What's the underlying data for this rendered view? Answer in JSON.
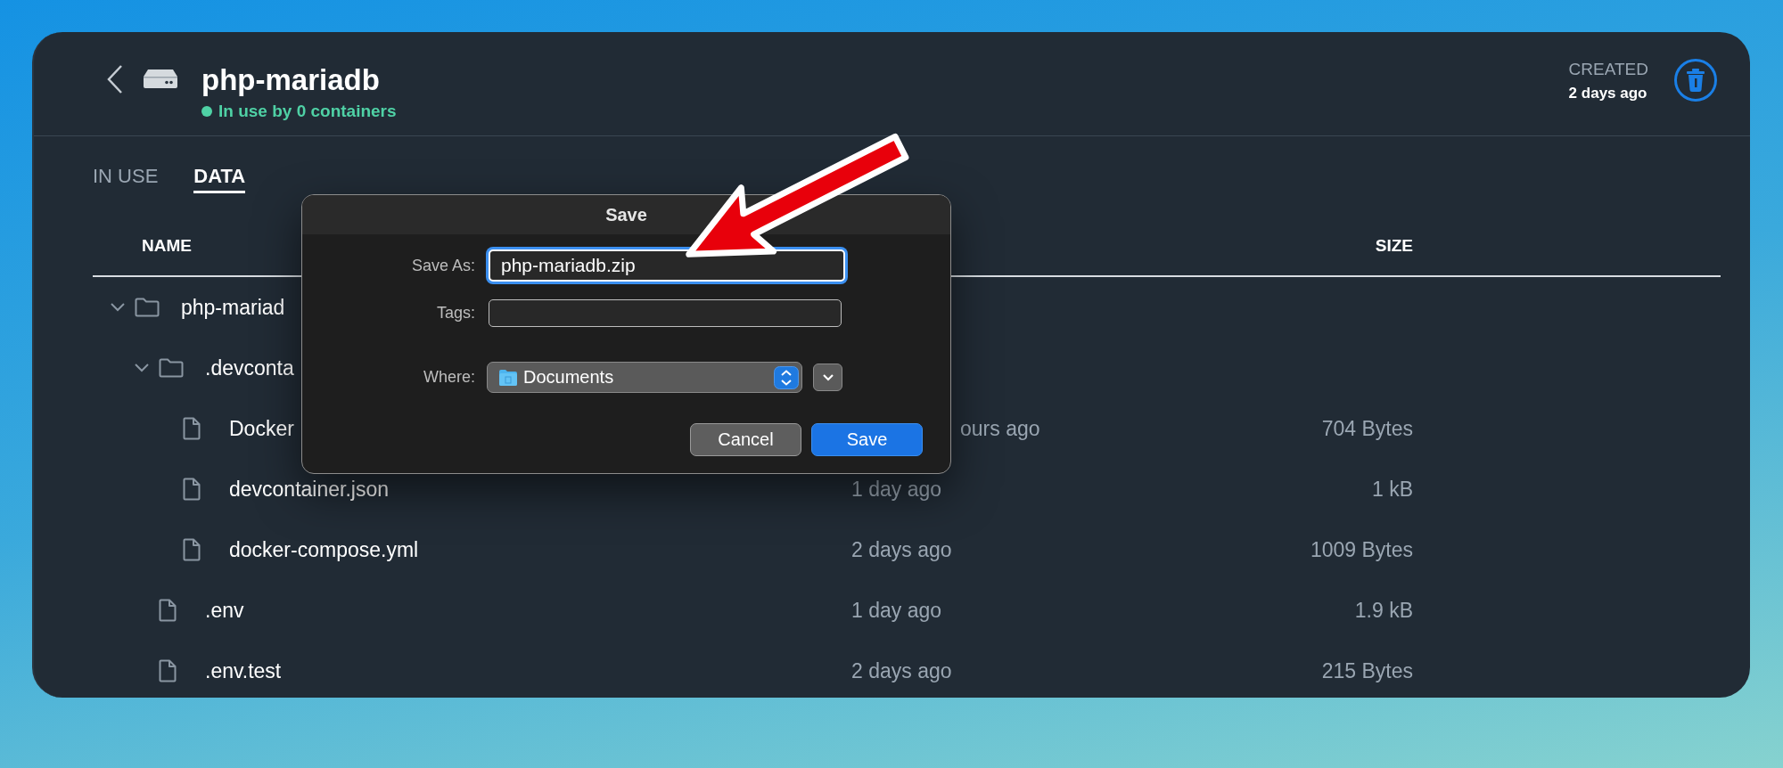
{
  "header": {
    "title": "php-mariadb",
    "status": "In use by 0 containers",
    "created": {
      "label": "CREATED",
      "value": "2 days ago"
    }
  },
  "tabs": [
    {
      "label": "IN USE",
      "selected": false
    },
    {
      "label": "DATA",
      "selected": true
    }
  ],
  "table": {
    "columns": [
      {
        "kind": "name",
        "label": "NAME"
      },
      {
        "kind": "size",
        "label": "SIZE"
      }
    ],
    "rows": [
      {
        "kind": "folder",
        "name": "php-mariad",
        "expanded": true,
        "children": [
          {
            "kind": "folder",
            "name": ".devconta",
            "expanded": true,
            "children": [
              {
                "kind": "file",
                "name": "Docker",
                "modified": "ours ago",
                "modified_cut_start": true,
                "size": "704 Bytes"
              },
              {
                "kind": "file",
                "name": "devcontainer.json",
                "modified": "1 day ago",
                "size": "1 kB"
              },
              {
                "kind": "file",
                "name": "docker-compose.yml",
                "modified": "2 days ago",
                "size": "1009 Bytes"
              }
            ]
          },
          {
            "kind": "file",
            "name": ".env",
            "modified": "1 day ago",
            "size": "1.9 kB"
          },
          {
            "kind": "file",
            "name": ".env.test",
            "modified": "2 days ago",
            "size": "215 Bytes"
          }
        ]
      }
    ]
  },
  "dialog": {
    "title": "Save",
    "fields": [
      {
        "kind": "text",
        "label": "Save As:",
        "value": "php-mariadb.zip",
        "focused": true
      },
      {
        "kind": "text",
        "label": "Tags:",
        "focused": false
      },
      {
        "kind": "popup",
        "label": "Where:",
        "value": "Documents"
      }
    ],
    "buttons": [
      {
        "label": "Cancel",
        "default": false
      },
      {
        "label": "Save",
        "default": true
      }
    ]
  }
}
